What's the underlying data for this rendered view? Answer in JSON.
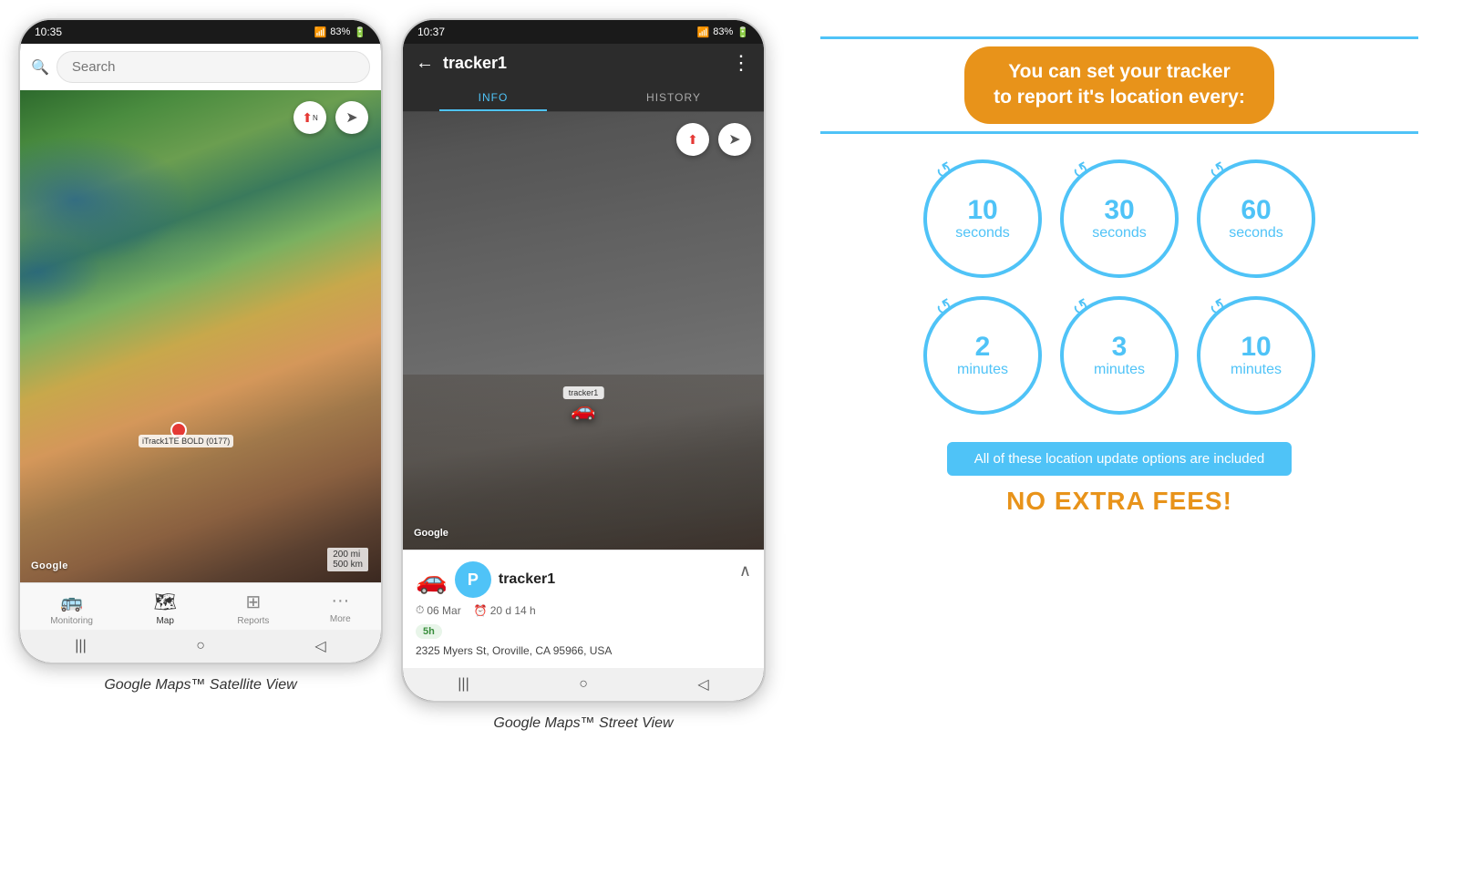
{
  "phone1": {
    "status_time": "10:35",
    "status_signal": "📶",
    "status_battery": "83%",
    "search_placeholder": "Search",
    "compass_icon": "⬆",
    "location_icon": "➤",
    "tracker_label": "iTrack1TE BOLD (0177)",
    "google_logo": "Google",
    "map_scale": "200 mi\n500 km",
    "nav_items": [
      {
        "icon": "🚌",
        "label": "Monitoring",
        "active": false
      },
      {
        "icon": "🗺",
        "label": "Map",
        "active": true
      },
      {
        "icon": "⊞",
        "label": "Reports",
        "active": false
      },
      {
        "icon": "···",
        "label": "More",
        "active": false
      }
    ],
    "bottom_btns": [
      "|||",
      "○",
      "◁"
    ],
    "caption": "Google Maps™ Satellite View"
  },
  "phone2": {
    "status_time": "10:37",
    "status_signal": "📶",
    "status_battery": "83%",
    "header_title": "tracker1",
    "back_icon": "←",
    "menu_icon": "⋮",
    "tabs": [
      {
        "label": "INFO",
        "active": true
      },
      {
        "label": "HISTORY",
        "active": false
      }
    ],
    "google_logo": "Google",
    "tracker_car": "🚗",
    "tracker_label_map": "tracker1",
    "tracker_info": {
      "name": "tracker1",
      "avatar": "P",
      "date": "06 Mar",
      "duration": "20 d 14 h",
      "address": "2325 Myers St, Oroville, CA 95966, USA",
      "badge": "5h"
    },
    "bottom_btns": [
      "|||",
      "○",
      "◁"
    ],
    "caption": "Google Maps™ Street View"
  },
  "info_panel": {
    "title_line1": "You can set your tracker",
    "title_line2": "to report it's location every:",
    "title_line_color": "#4fc3f7",
    "title_bg_color": "#e8931a",
    "circles": [
      {
        "number": "10",
        "unit": "seconds"
      },
      {
        "number": "30",
        "unit": "seconds"
      },
      {
        "number": "60",
        "unit": "seconds"
      },
      {
        "number": "2",
        "unit": "minutes"
      },
      {
        "number": "3",
        "unit": "minutes"
      },
      {
        "number": "10",
        "unit": "minutes"
      }
    ],
    "footer_text": "All of these location update options are included",
    "no_fees_text": "NO EXTRA FEES!",
    "accent_color": "#e8931a",
    "blue_color": "#4fc3f7"
  }
}
